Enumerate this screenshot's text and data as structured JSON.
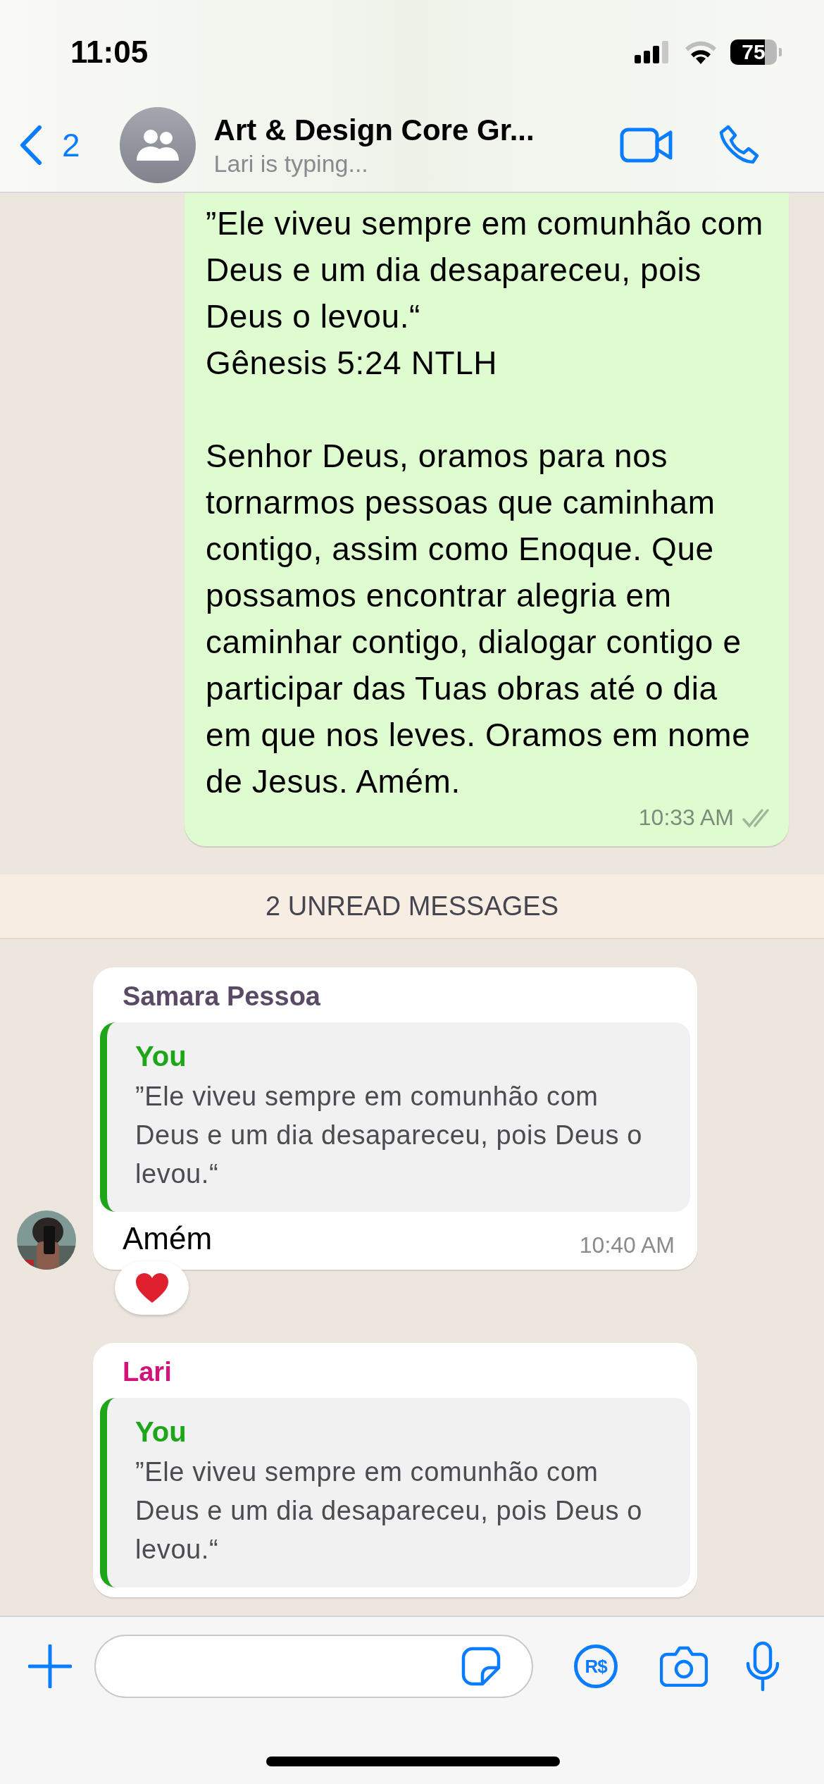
{
  "status_bar": {
    "time": "11:05",
    "battery": "75"
  },
  "header": {
    "back_count": "2",
    "title": "Art & Design Core Gr...",
    "subtitle": "Lari is typing..."
  },
  "messages": [
    {
      "kind": "outgoing",
      "text": "”Ele viveu sempre em comunhão com Deus e um dia desapareceu, pois Deus o levou.“\nGênesis 5:24 NTLH\n\nSenhor Deus, oramos para nos tornarmos pessoas que caminham contigo, assim como Enoque. Que possamos encontrar alegria em caminhar contigo, dialogar contigo e participar das Tuas obras até o dia em que nos leves. Oramos em nome de Jesus. Amém.",
      "time": "10:33 AM",
      "delivered": true,
      "read": false
    },
    {
      "kind": "unread_banner",
      "text": "2 UNREAD MESSAGES"
    },
    {
      "kind": "incoming",
      "sender": "Samara Pessoa",
      "color": "#5b4a66",
      "quote": {
        "author": "You",
        "text": "”Ele viveu sempre em comunhão com Deus e um dia desapareceu, pois Deus o levou.“"
      },
      "text": "Amém",
      "time": "10:40 AM",
      "heart_reaction": true
    },
    {
      "kind": "incoming",
      "sender": "Lari",
      "color": "#d4137a",
      "quote": {
        "author": "You",
        "text": "”Ele viveu sempre em comunhão com Deus e um dia desapareceu, pois Deus o levou.“"
      }
    }
  ],
  "composer": {
    "payment_label": "R$"
  }
}
